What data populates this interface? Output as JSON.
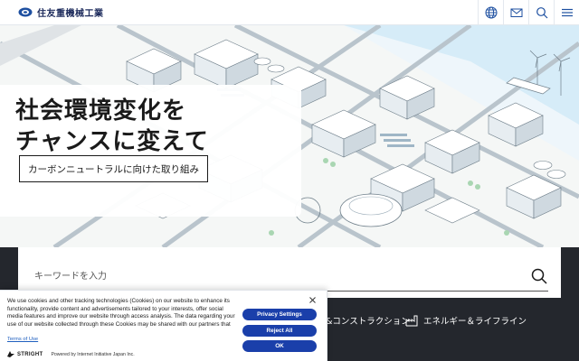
{
  "header": {
    "logo_text": "住友重機械工業",
    "icons": [
      "globe-icon",
      "mail-icon",
      "search-icon",
      "menu-icon"
    ]
  },
  "hero": {
    "headline_line1": "社会環境変化を",
    "headline_line2": "チャンスに変えて",
    "cta_label": "カーボンニュートラルに向けた取り組み"
  },
  "search": {
    "placeholder": "キーワードを入力"
  },
  "nav": {
    "item_construction": "&コンストラクション",
    "item_energy": "エネルギー＆ライフライン"
  },
  "cookie": {
    "text": "We use cookies and other tracking technologies (Cookies) on our website to enhance its functionality, provide content and advertisements tailored to your interests, offer social media features and improve our website through access analysis. The data regarding your use of our website collected through these Cookies may be shared with our partners that",
    "terms_link": "Terms of Use",
    "brand": "STRIGHT",
    "powered_by": "Powered by Internet Initiative Japan Inc.",
    "privacy_settings": "Privacy Settings",
    "reject_all": "Reject All",
    "ok": "OK"
  },
  "colors": {
    "brand_navy": "#1d2b5c",
    "dark_band": "#24272d",
    "cookie_button": "#1a3faa",
    "link_blue": "#1f5fbf"
  }
}
